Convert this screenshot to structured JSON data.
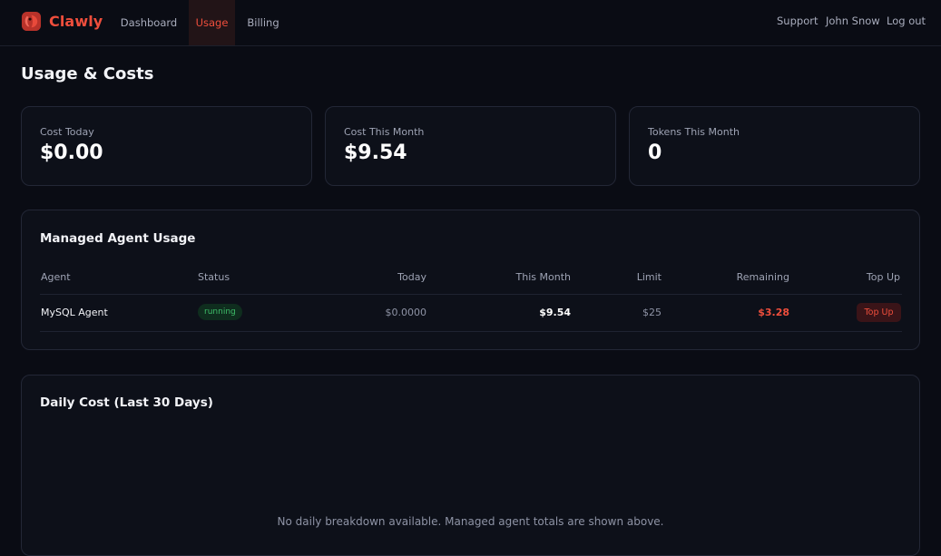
{
  "brand": {
    "name": "Clawly",
    "accent": "#ef4e3c"
  },
  "nav": {
    "tabs": [
      {
        "label": "Dashboard",
        "active": false
      },
      {
        "label": "Usage",
        "active": true
      },
      {
        "label": "Billing",
        "active": false
      }
    ],
    "right": {
      "support": "Support",
      "user": "John Snow",
      "logout": "Log out"
    }
  },
  "page": {
    "title": "Usage & Costs"
  },
  "stats": [
    {
      "label": "Cost Today",
      "value": "$0.00"
    },
    {
      "label": "Cost This Month",
      "value": "$9.54"
    },
    {
      "label": "Tokens This Month",
      "value": "0"
    }
  ],
  "agents": {
    "title": "Managed Agent Usage",
    "columns": {
      "agent": "Agent",
      "status": "Status",
      "today": "Today",
      "month": "This Month",
      "limit": "Limit",
      "remaining": "Remaining",
      "topup": "Top Up"
    },
    "rows": [
      {
        "agent": "MySQL Agent",
        "status": "running",
        "today": "$0.0000",
        "month": "$9.54",
        "limit": "$25",
        "remaining": "$3.28",
        "topup": "Top Up"
      }
    ]
  },
  "daily": {
    "title": "Daily Cost (Last 30 Days)",
    "empty": "No daily breakdown available. Managed agent totals are shown above."
  }
}
